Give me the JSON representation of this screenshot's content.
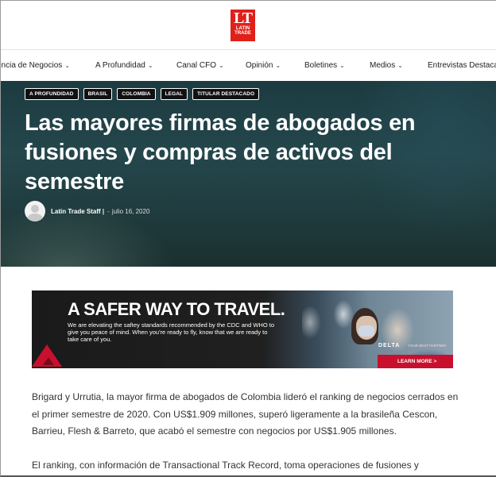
{
  "header": {
    "logo_text": "LT",
    "logo_subtext": "LATIN TRADE",
    "brand_color": "#e0201b"
  },
  "nav": {
    "items": [
      {
        "label": "encia de Negocios"
      },
      {
        "label": "A Profundidad"
      },
      {
        "label": "Canal CFO"
      },
      {
        "label": "Opinión"
      },
      {
        "label": "Boletines"
      },
      {
        "label": "Medios"
      },
      {
        "label": "Entrevistas Destaca"
      }
    ],
    "chevron_icon": "chevron-down-icon"
  },
  "hero": {
    "tags": [
      "A PROFUNDIDAD",
      "BRASIL",
      "COLOMBIA",
      "LEGAL",
      "TITULAR DESTACADO"
    ],
    "title": "Las mayores firmas de abogados en fusiones y compras de activos del semestre",
    "author": "Latin Trade Staff |",
    "separator": "-",
    "date": "julio 16, 2020",
    "avatar_icon": "user-avatar-icon"
  },
  "ad": {
    "headline": "A SAFER WAY TO TRAVEL.",
    "body": "We are elevating the saftey standards recommended by the CDC and WHO to give you peace of mind. When you're ready to fly, know that we are ready to take care of you.",
    "brand": "DELTA",
    "partner_text": "YOUR BEST PARTNER",
    "cta": "LEARN MORE >",
    "brand_color": "#c8102e"
  },
  "article": {
    "paragraphs": [
      "Brigard y Urrutia, la mayor firma de abogados de Colombia lideró el ranking de negocios cerrados en el primer semestre de 2020. Con US$1.909 millones, superó ligeramente a la brasileña Cescon, Barrieu, Flesh & Barreto, que acabó el semestre con negocios por US$1.905 millones.",
      "El ranking, con información de Transactional Track Record, toma operaciones de fusiones y"
    ]
  }
}
